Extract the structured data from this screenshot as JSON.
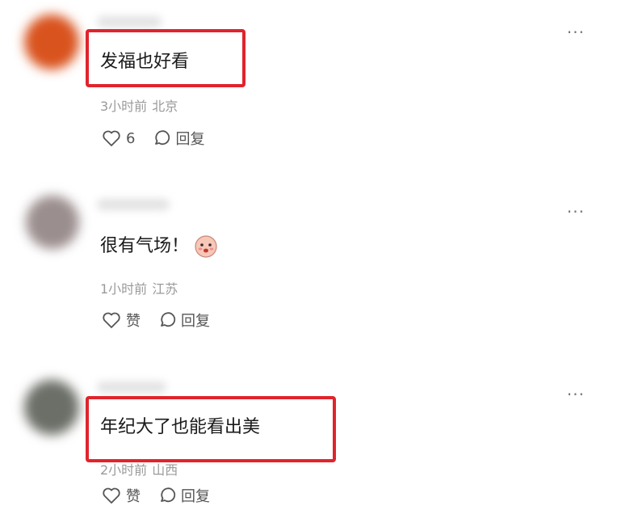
{
  "comments": [
    {
      "text": "发福也好看",
      "time": "3小时前",
      "location": "北京",
      "like_label": "6",
      "reply_label": "回复",
      "highlighted": true,
      "avatar_color": "#d9531e"
    },
    {
      "text": "很有气场！",
      "emoji": "face-emoji",
      "time": "1小时前",
      "location": "江苏",
      "like_label": "赞",
      "reply_label": "回复",
      "highlighted": false,
      "avatar_color": "#9b8e8e"
    },
    {
      "text": "年纪大了也能看出美",
      "time": "2小时前",
      "location": "山西",
      "like_label": "赞",
      "reply_label": "回复",
      "highlighted": true,
      "avatar_color": "#6c6f68"
    }
  ],
  "more_label": "···",
  "colors": {
    "highlight": "#e0242c",
    "meta": "#9a9a9a"
  },
  "icons": {
    "like": "heart-outline-icon",
    "reply": "speech-bubble-icon",
    "more": "more-dots-icon"
  }
}
